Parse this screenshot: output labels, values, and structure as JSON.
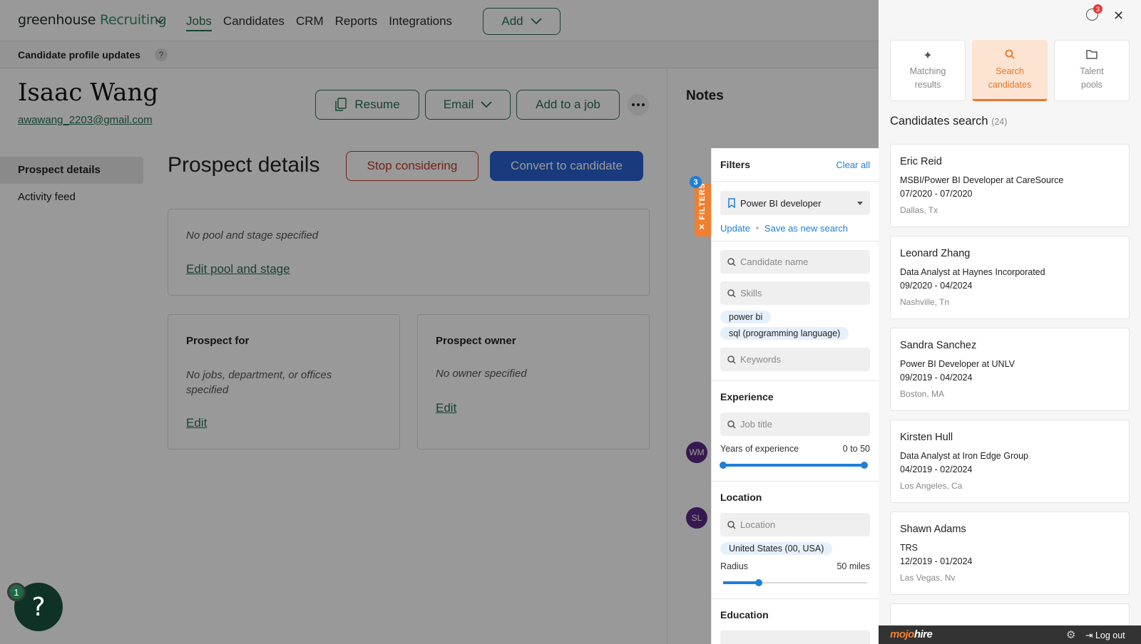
{
  "app": {
    "logo_main": "greenhouse",
    "logo_accent": "Recruiting",
    "nav": [
      "Jobs",
      "Candidates",
      "CRM",
      "Reports",
      "Integrations"
    ],
    "add_label": "Add"
  },
  "subbar": {
    "title": "Candidate profile updates",
    "help": "?"
  },
  "profile": {
    "name": "Isaac Wang",
    "email": "awawang_2203@gmail.com",
    "resume_label": "Resume",
    "email_label": "Email",
    "add_to_job_label": "Add to a job"
  },
  "left_nav": [
    "Prospect details",
    "Activity feed"
  ],
  "prospect": {
    "title": "Prospect details",
    "stop_label": "Stop considering",
    "convert_label": "Convert to candidate",
    "pool_text": "No pool and stage specified",
    "pool_link": "Edit pool and stage",
    "for_title": "Prospect for",
    "for_text": "No jobs, department, or offices specified",
    "for_link": "Edit",
    "owner_title": "Prospect owner",
    "owner_text": "No owner specified",
    "owner_link": "Edit"
  },
  "notes": {
    "title": "Notes",
    "avatars": [
      "WM",
      "SL"
    ]
  },
  "help": {
    "badge": "1",
    "glyph": "?"
  },
  "filters": {
    "tab_label": "✕ FILTERS",
    "tab_badge": "3",
    "title": "Filters",
    "clear": "Clear all",
    "saved_search": "Power BI developer",
    "update": "Update",
    "save_new": "Save as new search",
    "candidate_name_ph": "Candidate name",
    "skills_ph": "Skills",
    "skills": [
      "power bi",
      "sql (programming language)"
    ],
    "keywords_ph": "Keywords",
    "experience_title": "Experience",
    "job_title_ph": "Job title",
    "years_label": "Years of experience",
    "years_value": "0 to 50",
    "years_range": [
      0,
      50
    ],
    "location_title": "Location",
    "location_ph": "Location",
    "location_chip": "United States (00, USA)",
    "radius_label": "Radius",
    "radius_value": "50 miles",
    "radius_fraction": 0.25,
    "education_title": "Education"
  },
  "right_panel": {
    "notif_count": "3",
    "tabs": [
      {
        "line1": "Matching",
        "line2": "results",
        "icon": "sparkle-icon"
      },
      {
        "line1": "Search",
        "line2": "candidates",
        "icon": "search-icon"
      },
      {
        "line1": "Talent",
        "line2": "pools",
        "icon": "folder-icon"
      }
    ],
    "title": "Candidates search",
    "count": "(24)",
    "candidates": [
      {
        "name": "Eric Reid",
        "role": "MSBI/Power BI Developer at CareSource",
        "dates": "07/2020 - 07/2020",
        "location": "Dallas, Tx"
      },
      {
        "name": "Leonard Zhang",
        "role": "Data Analyst at Haynes Incorporated",
        "dates": "09/2020 - 04/2024",
        "location": "Nashville, Tn"
      },
      {
        "name": "Sandra Sanchez",
        "role": "Power BI Developer at UNLV",
        "dates": "09/2019 - 04/2024",
        "location": "Boston, MA"
      },
      {
        "name": "Kirsten Hull",
        "role": "Data Analyst at Iron Edge Group",
        "dates": "04/2019 - 02/2024",
        "location": "Los Angeles, Ca"
      },
      {
        "name": "Shawn Adams",
        "role": "TRS",
        "dates": "12/2019 - 01/2024",
        "location": "Las Vegas, Nv"
      }
    ],
    "brand_a": "mojo",
    "brand_b": "hire",
    "logout": "Log out"
  },
  "colors": {
    "accent_green": "#2a6e53",
    "convert_blue": "#2b62d1",
    "filters_orange": "#f07f2f",
    "link_blue": "#1f7fd6"
  }
}
